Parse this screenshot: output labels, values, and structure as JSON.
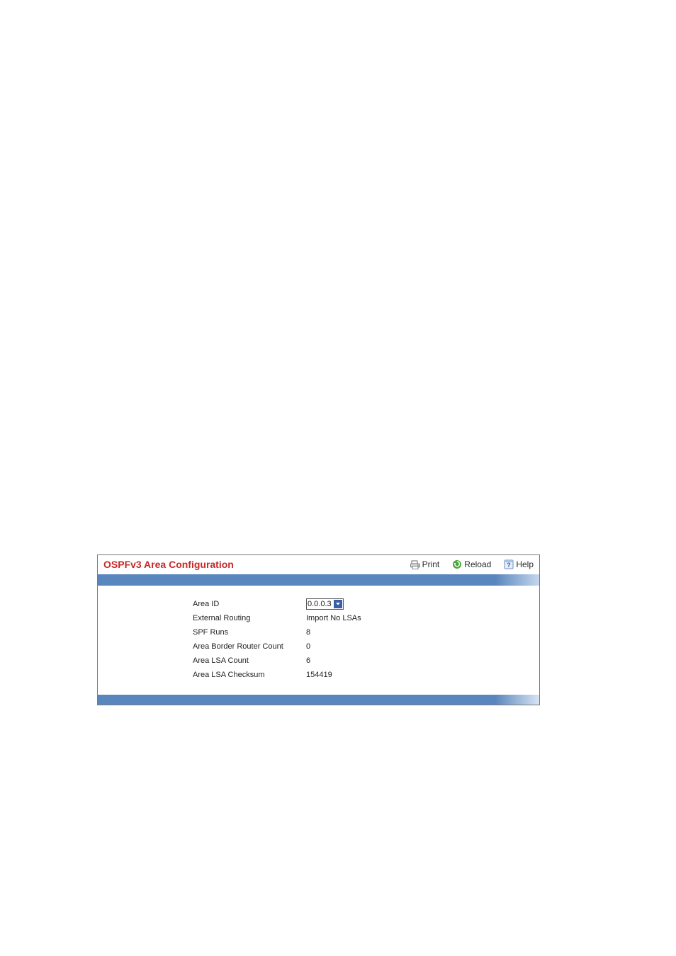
{
  "header": {
    "title": "OSPFv3 Area Configuration",
    "actions": {
      "print": "Print",
      "reload": "Reload",
      "help": "Help"
    }
  },
  "form": {
    "area_id": {
      "label": "Area ID",
      "value": "0.0.0.3"
    },
    "external_routing": {
      "label": "External Routing",
      "value": "Import No LSAs"
    },
    "spf_runs": {
      "label": "SPF Runs",
      "value": "8"
    },
    "area_border_router_count": {
      "label": "Area Border Router Count",
      "value": "0"
    },
    "area_lsa_count": {
      "label": "Area LSA Count",
      "value": "6"
    },
    "area_lsa_checksum": {
      "label": "Area LSA Checksum",
      "value": "154419"
    }
  }
}
